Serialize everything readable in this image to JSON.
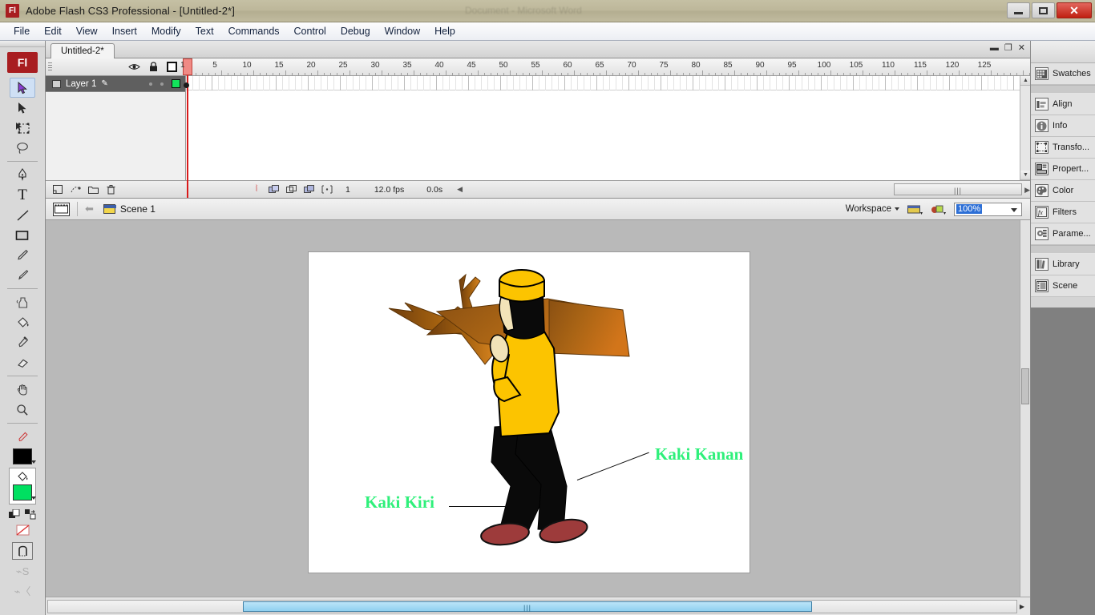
{
  "window": {
    "app_badge": "Fl",
    "title": "Adobe Flash CS3 Professional - [Untitled-2*]",
    "ghost_title": "Document - Microsoft Word",
    "minimize": "minimize-button",
    "maximize": "restore-button",
    "close": "close-button"
  },
  "menubar": {
    "items": [
      {
        "label": "File"
      },
      {
        "label": "Edit"
      },
      {
        "label": "View"
      },
      {
        "label": "Insert"
      },
      {
        "label": "Modify"
      },
      {
        "label": "Text"
      },
      {
        "label": "Commands"
      },
      {
        "label": "Control"
      },
      {
        "label": "Debug"
      },
      {
        "label": "Window"
      },
      {
        "label": "Help"
      }
    ]
  },
  "toolbar": {
    "badge": "Fl",
    "tools": [
      {
        "name": "selection-tool",
        "selected": true
      },
      {
        "name": "subselection-tool",
        "selected": false
      },
      {
        "name": "free-transform-tool",
        "selected": false
      },
      {
        "name": "lasso-tool",
        "selected": false
      },
      {
        "name": "pen-tool",
        "selected": false
      },
      {
        "name": "text-tool",
        "selected": false
      },
      {
        "name": "line-tool",
        "selected": false
      },
      {
        "name": "rectangle-tool",
        "selected": false
      },
      {
        "name": "pencil-tool",
        "selected": false
      },
      {
        "name": "brush-tool",
        "selected": false
      },
      {
        "name": "ink-bottle-tool",
        "selected": false
      },
      {
        "name": "paint-bucket-tool",
        "selected": false
      },
      {
        "name": "eyedropper-tool",
        "selected": false
      },
      {
        "name": "eraser-tool",
        "selected": false
      },
      {
        "name": "hand-tool",
        "selected": false
      },
      {
        "name": "zoom-tool",
        "selected": false
      }
    ],
    "stroke_color": "#000000",
    "fill_color": "#00E061"
  },
  "document_tab": {
    "label": "Untitled-2*"
  },
  "timeline": {
    "layer_column_icons": [
      "eye-icon",
      "lock-icon",
      "outline-icon"
    ],
    "layers": [
      {
        "name": "Layer 1",
        "color": "#12E35B"
      }
    ],
    "ruler_marks": [
      1,
      5,
      10,
      15,
      20,
      25,
      30,
      35,
      40,
      45,
      50,
      55,
      60,
      65,
      70,
      75,
      80,
      85,
      90,
      95,
      100,
      105,
      110,
      115,
      120,
      125
    ],
    "playhead_frame": "1",
    "status": {
      "current_frame": "1",
      "fps": "12.0 fps",
      "elapsed": "0.0s"
    },
    "buttons": [
      "new-layer-button",
      "add-motion-guide-button",
      "new-folder-button",
      "delete-layer-button",
      "onion-skin-button",
      "onion-skin-outlines-button",
      "edit-multiple-frames-button",
      "modify-onion-markers-button"
    ]
  },
  "editbar": {
    "scene_name": "Scene 1",
    "workspace_label": "Workspace",
    "zoom_value": "100%"
  },
  "stage": {
    "background": "#FFFFFF",
    "annotations": [
      {
        "text": "Kaki Kanan",
        "color": "#2EF07A"
      },
      {
        "text": "Kaki Kiri",
        "color": "#2EF07A"
      }
    ],
    "artwork": {
      "name": "man-carrying-branch",
      "colors": {
        "cap_shirt_yellow": "#FCC400",
        "hair_pants_black": "#0A0A0A",
        "skin_cream": "#F2E3B8",
        "shoe_red": "#A03A3A",
        "branch_dark": "#7A4A10",
        "branch_light": "#C86A18"
      }
    }
  },
  "right_panel": {
    "items": [
      {
        "label": "Swatches",
        "icon": "swatches-icon"
      },
      {
        "label": "Align",
        "icon": "align-icon"
      },
      {
        "label": "Info",
        "icon": "info-icon"
      },
      {
        "label": "Transfo...",
        "icon": "transform-icon"
      },
      {
        "label": "Propert...",
        "icon": "properties-icon"
      },
      {
        "label": "Color",
        "icon": "color-icon"
      },
      {
        "label": "Filters",
        "icon": "filters-icon"
      },
      {
        "label": "Parame...",
        "icon": "parameters-icon"
      },
      {
        "label": "Library",
        "icon": "library-icon"
      },
      {
        "label": "Scene",
        "icon": "scene-icon"
      }
    ]
  }
}
